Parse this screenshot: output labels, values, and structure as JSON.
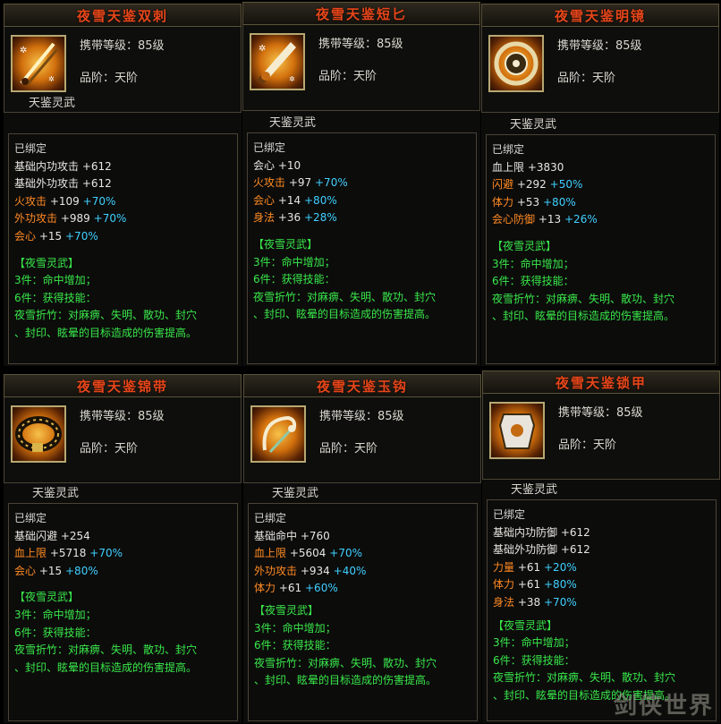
{
  "cards": [
    {
      "name": "夜雪天鉴双刺",
      "level_text": "携带等级：85级",
      "grade_text": "品阶：天阶",
      "series": "天鉴灵武",
      "bound": "已绑定",
      "stats": [
        {
          "key": "基础内功攻击",
          "value": "+612",
          "bonus": "",
          "fire": false
        },
        {
          "key": "基础外功攻击",
          "value": "+612",
          "bonus": "",
          "fire": false
        },
        {
          "key": "火攻击",
          "value": "+109",
          "bonus": "+70%",
          "fire": true
        },
        {
          "key": "外功攻击",
          "value": "+989",
          "bonus": "+70%",
          "fire": false
        },
        {
          "key": "会心",
          "value": "+15",
          "bonus": "+70%",
          "fire": false
        }
      ],
      "set_title": "【夜雪灵武】",
      "set_lines": [
        "3件：命中增加；",
        "6件：获得技能：",
        "夜雪折竹：对麻痹、失明、散功、封穴",
        "、封印、眩晕的目标造成的伤害提高。"
      ],
      "icon": "twin-daggers-icon"
    },
    {
      "name": "夜雪天鉴短匕",
      "level_text": "携带等级：85级",
      "grade_text": "品阶：天阶",
      "series": "天鉴灵武",
      "bound": "已绑定",
      "stats": [
        {
          "key": "会心",
          "value": "+10",
          "bonus": "",
          "fire": false
        },
        {
          "key": "火攻击",
          "value": "+97",
          "bonus": "+70%",
          "fire": true
        },
        {
          "key": "会心",
          "value": "+14",
          "bonus": "+80%",
          "fire": false
        },
        {
          "key": "身法",
          "value": "+36",
          "bonus": "+28%",
          "fire": false
        }
      ],
      "set_title": "【夜雪灵武】",
      "set_lines": [
        "3件：命中增加；",
        "6件：获得技能：",
        "夜雪折竹：对麻痹、失明、散功、封穴",
        "、封印、眩晕的目标造成的伤害提高。"
      ],
      "icon": "dagger-icon"
    },
    {
      "name": "夜雪天鉴明镜",
      "level_text": "携带等级：85级",
      "grade_text": "品阶：天阶",
      "series": "天鉴灵武",
      "bound": "已绑定",
      "stats": [
        {
          "key": "血上限",
          "value": "+3830",
          "bonus": "",
          "fire": false
        },
        {
          "key": "闪避",
          "value": "+292",
          "bonus": "+50%",
          "fire": false
        },
        {
          "key": "体力",
          "value": "+53",
          "bonus": "+80%",
          "fire": false
        },
        {
          "key": "会心防御",
          "value": "+13",
          "bonus": "+26%",
          "fire": false
        }
      ],
      "set_title": "【夜雪灵武】",
      "set_lines": [
        "3件：命中增加；",
        "6件：获得技能：",
        "夜雪折竹：对麻痹、失明、散功、封穴",
        "、封印、眩晕的目标造成的伤害提高。"
      ],
      "icon": "mirror-icon"
    },
    {
      "name": "夜雪天鉴锦带",
      "level_text": "携带等级：85级",
      "grade_text": "品阶：天阶",
      "series": "天鉴灵武",
      "bound": "已绑定",
      "stats": [
        {
          "key": "基础闪避",
          "value": "+254",
          "bonus": "",
          "fire": false
        },
        {
          "key": "血上限",
          "value": "+5718",
          "bonus": "+70%",
          "fire": false
        },
        {
          "key": "会心",
          "value": "+15",
          "bonus": "+80%",
          "fire": false
        }
      ],
      "set_title": "【夜雪灵武】",
      "set_lines": [
        "3件：命中增加；",
        "6件：获得技能：",
        "夜雪折竹：对麻痹、失明、散功、封穴",
        "、封印、眩晕的目标造成的伤害提高。"
      ],
      "icon": "belt-icon"
    },
    {
      "name": "夜雪天鉴玉钩",
      "level_text": "携带等级：85级",
      "grade_text": "品阶：天阶",
      "series": "天鉴灵武",
      "bound": "已绑定",
      "stats": [
        {
          "key": "基础命中",
          "value": "+760",
          "bonus": "",
          "fire": false
        },
        {
          "key": "血上限",
          "value": "+5604",
          "bonus": "+70%",
          "fire": false
        },
        {
          "key": "外功攻击",
          "value": "+934",
          "bonus": "+40%",
          "fire": false
        },
        {
          "key": "体力",
          "value": "+61",
          "bonus": "+60%",
          "fire": false
        }
      ],
      "set_title": "【夜雪灵武】",
      "set_lines": [
        "3件：命中增加；",
        "6件：获得技能：",
        "夜雪折竹：对麻痹、失明、散功、封穴",
        "、封印、眩晕的目标造成的伤害提高。"
      ],
      "icon": "jade-hook-icon"
    },
    {
      "name": "夜雪天鉴锁甲",
      "level_text": "携带等级：85级",
      "grade_text": "品阶：天阶",
      "series": "天鉴灵武",
      "bound": "已绑定",
      "stats": [
        {
          "key": "基础内功防御",
          "value": "+612",
          "bonus": "",
          "fire": false
        },
        {
          "key": "基础外功防御",
          "value": "+612",
          "bonus": "",
          "fire": false
        },
        {
          "key": "力量",
          "value": "+61",
          "bonus": "+20%",
          "fire": false
        },
        {
          "key": "体力",
          "value": "+61",
          "bonus": "+80%",
          "fire": false
        },
        {
          "key": "身法",
          "value": "+38",
          "bonus": "+70%",
          "fire": false
        }
      ],
      "set_title": "【夜雪灵武】",
      "set_lines": [
        "3件：命中增加；",
        "6件：获得技能：",
        "夜雪折竹：对麻痹、失明、散功、封穴",
        "、封印、眩晕的目标造成的伤害提高。"
      ],
      "icon": "chain-armor-icon"
    }
  ],
  "watermark": "剑侠世界"
}
